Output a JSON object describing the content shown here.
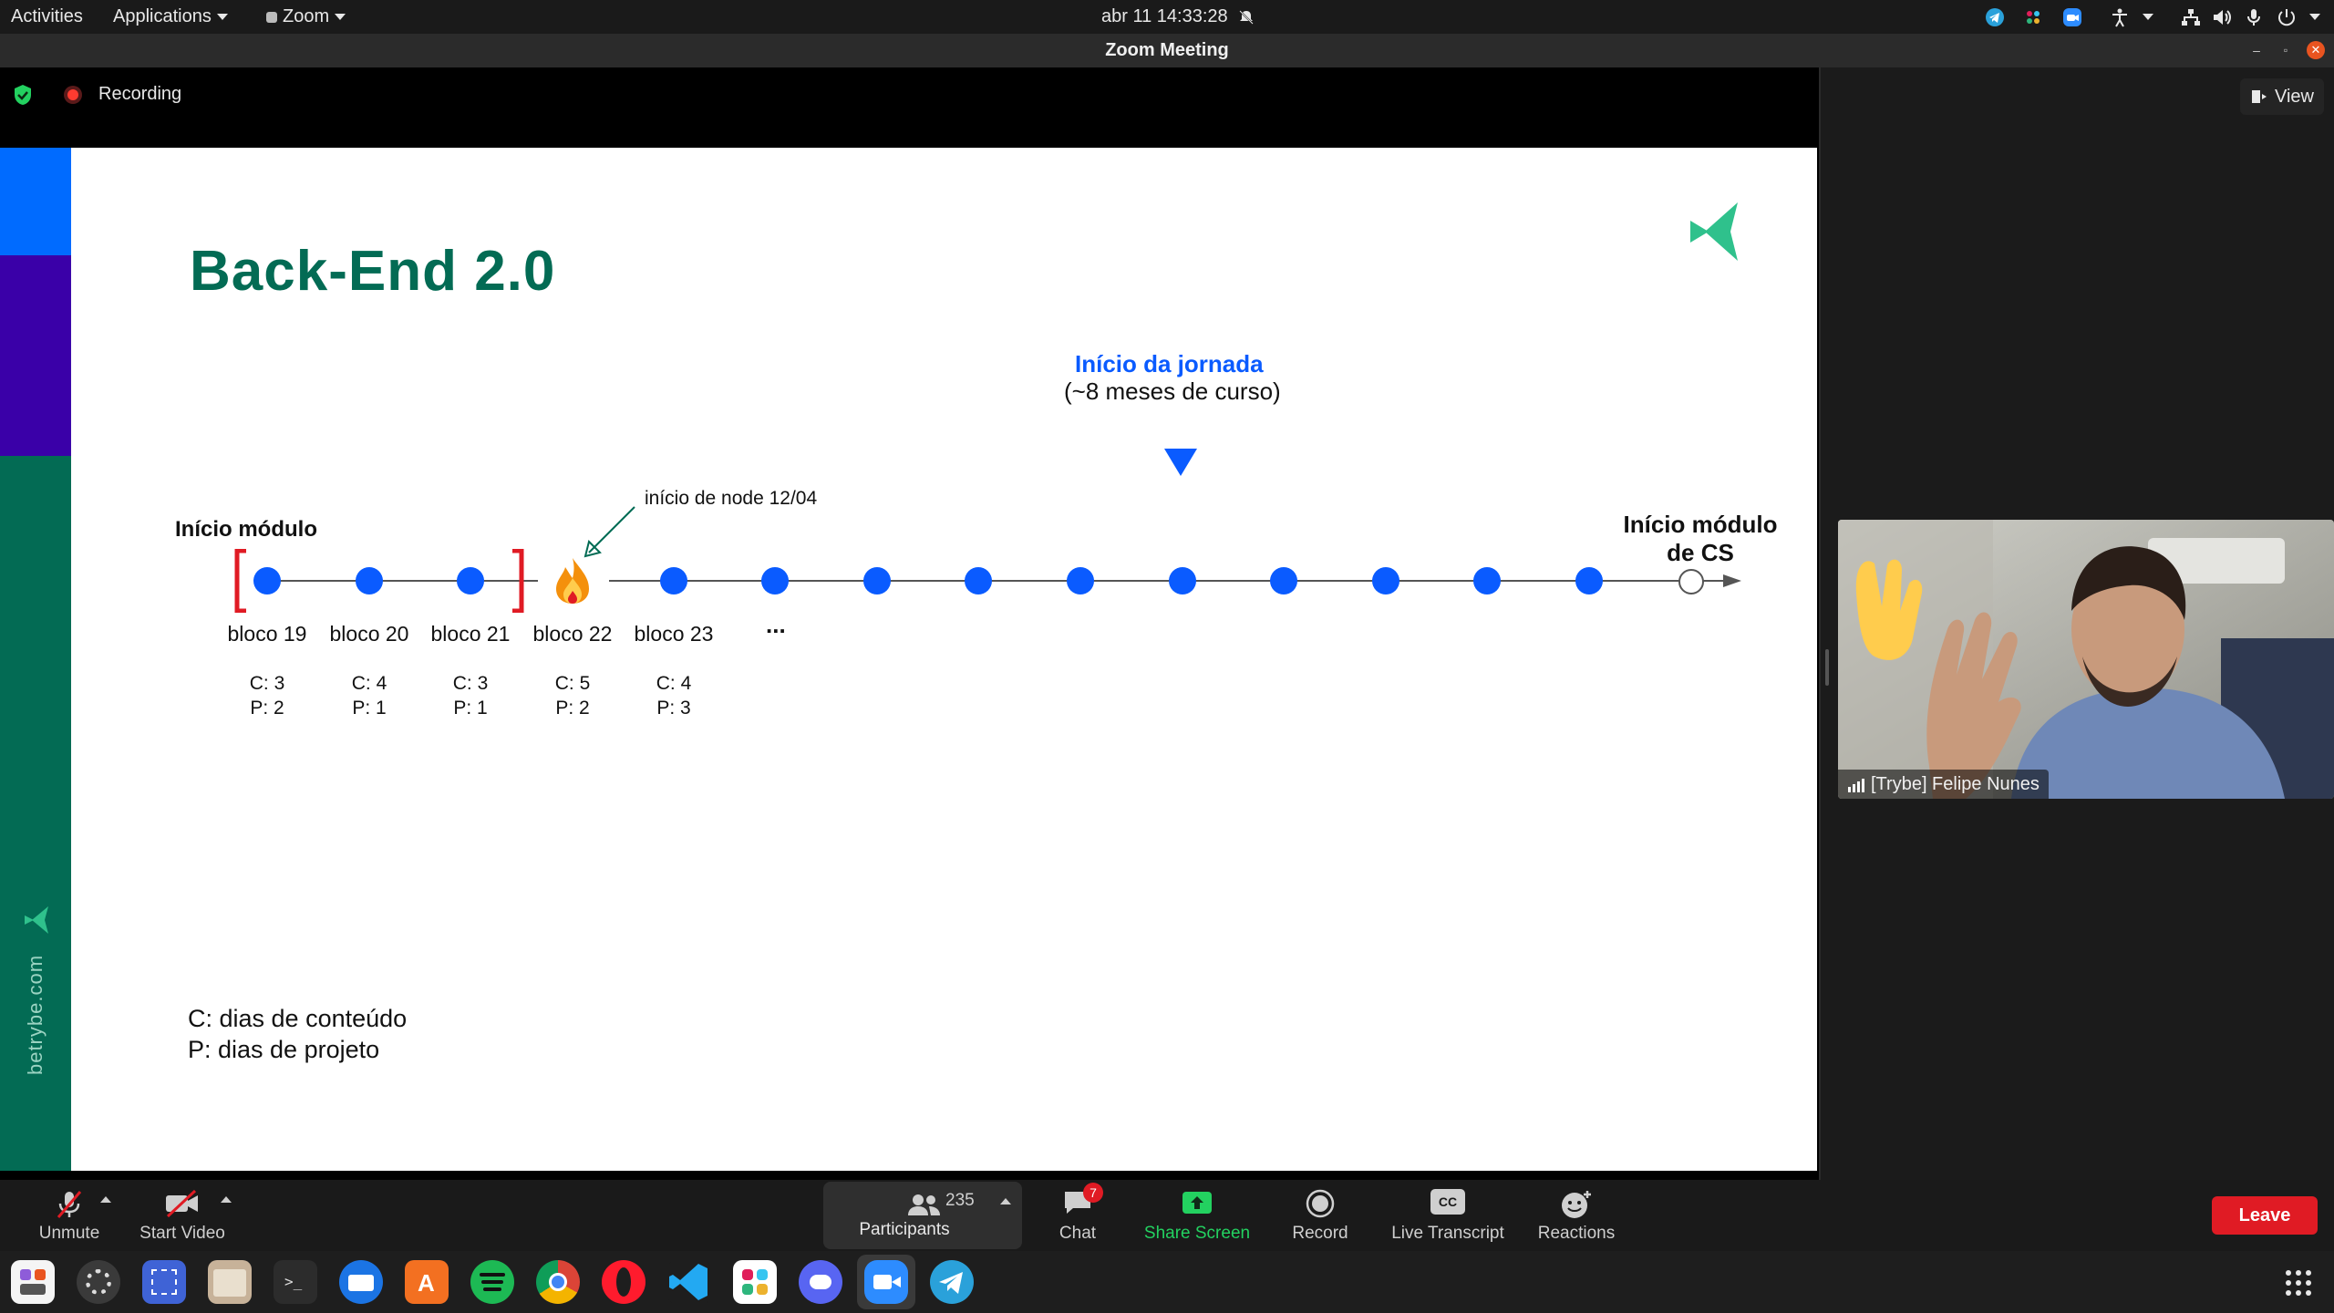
{
  "topbar": {
    "activities": "Activities",
    "applications": "Applications",
    "zoom_menu": "Zoom",
    "datetime": "abr 11  14:33:28"
  },
  "window": {
    "title": "Zoom Meeting"
  },
  "recording": {
    "label": "Recording"
  },
  "view_button": {
    "label": "View"
  },
  "slide": {
    "title": "Back-End 2.0",
    "journey_title": "Início da jornada",
    "journey_sub": "(~8 meses de curso)",
    "module_start": "Início módulo",
    "cs_start_line1": "Início módulo",
    "cs_start_line2": "de CS",
    "node_note": "início de node 12/04",
    "blocks": [
      {
        "label": "bloco 19",
        "c": "C: 3",
        "p": "P: 2"
      },
      {
        "label": "bloco 20",
        "c": "C: 4",
        "p": "P: 1"
      },
      {
        "label": "bloco 21",
        "c": "C: 3",
        "p": "P: 1"
      },
      {
        "label": "bloco 22",
        "c": "C: 5",
        "p": "P: 2"
      },
      {
        "label": "bloco 23",
        "c": "C: 4",
        "p": "P: 3"
      }
    ],
    "ellipsis": "...",
    "legend_c": "C: dias de conteúdo",
    "legend_p": "P: dias de projeto",
    "side_url": "betrybe.com",
    "colors": {
      "green": "#036b54",
      "blue": "#0a5bff",
      "red": "#e01b24"
    }
  },
  "video": {
    "participant_name": "[Trybe] Felipe Nunes"
  },
  "toolbar": {
    "unmute": "Unmute",
    "start_video": "Start Video",
    "participants_count": "235",
    "participants": "Participants",
    "chat": "Chat",
    "chat_badge": "7",
    "share_screen": "Share Screen",
    "record": "Record",
    "live_transcript": "Live Transcript",
    "cc": "CC",
    "reactions": "Reactions",
    "leave": "Leave"
  },
  "dock": {
    "apps": [
      "app-grid-icon",
      "settings-icon",
      "screenshot-icon",
      "files-icon",
      "terminal-icon",
      "thunderbird-icon",
      "software-store-icon",
      "spotify-icon",
      "chrome-icon",
      "opera-icon",
      "vscode-icon",
      "slack-icon",
      "discord-icon",
      "zoom-icon",
      "telegram-icon"
    ]
  }
}
